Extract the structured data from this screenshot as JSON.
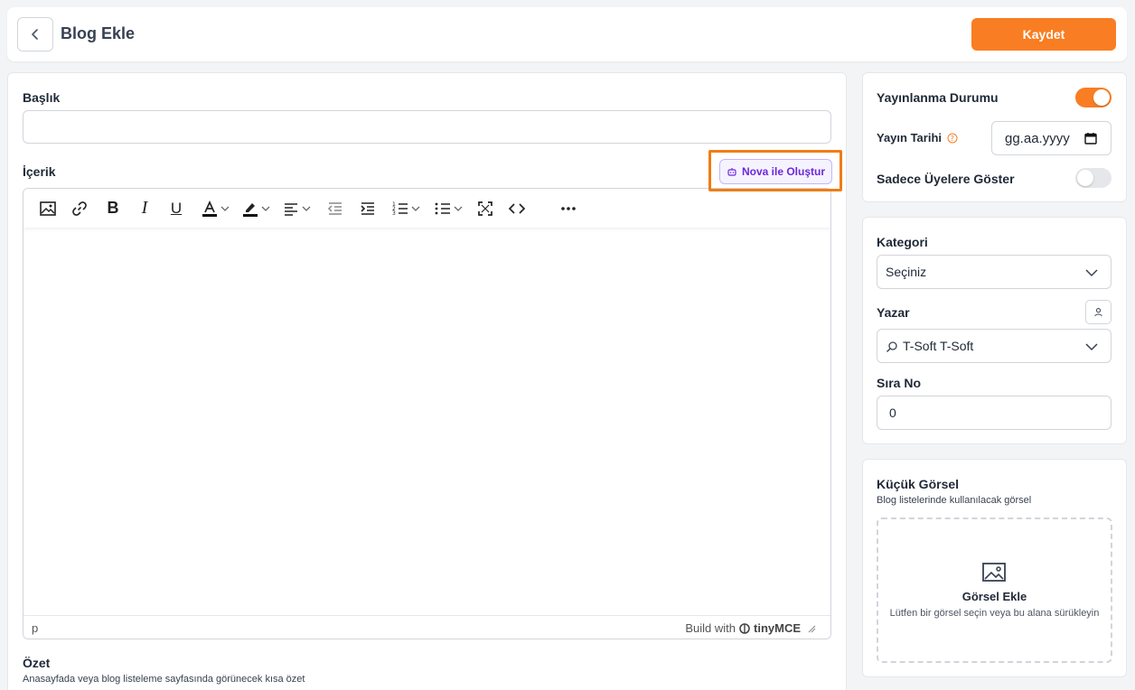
{
  "header": {
    "title": "Blog Ekle",
    "save_label": "Kaydet"
  },
  "form": {
    "title_label": "Başlık",
    "title_value": "",
    "content_label": "İçerik",
    "nova_button": "Nova ile Oluştur",
    "editor": {
      "status_path": "p",
      "brand_prefix": "Build with",
      "brand_name": "tinyMCE"
    },
    "summary_label": "Özet",
    "summary_help": "Anasayfada veya blog listeleme sayfasında görünecek kısa özet"
  },
  "publish": {
    "status_label": "Yayınlanma Durumu",
    "status_on": true,
    "date_label": "Yayın Tarihi",
    "date_placeholder": "gg.aa.yyyy",
    "members_only_label": "Sadece Üyelere Göster",
    "members_only_on": false
  },
  "meta": {
    "category_label": "Kategori",
    "category_value": "Seçiniz",
    "author_label": "Yazar",
    "author_value": "T-Soft T-Soft",
    "order_label": "Sıra No",
    "order_value": "0"
  },
  "thumbnail": {
    "title": "Küçük Görsel",
    "help": "Blog listelerinde kullanılacak görsel",
    "add_label": "Görsel Ekle",
    "add_help": "Lütfen bir görsel seçin veya bu alana sürükleyin"
  },
  "colors": {
    "accent": "#f97d22",
    "nova": "#6d28d9",
    "highlight_border": "#ef7d15"
  }
}
